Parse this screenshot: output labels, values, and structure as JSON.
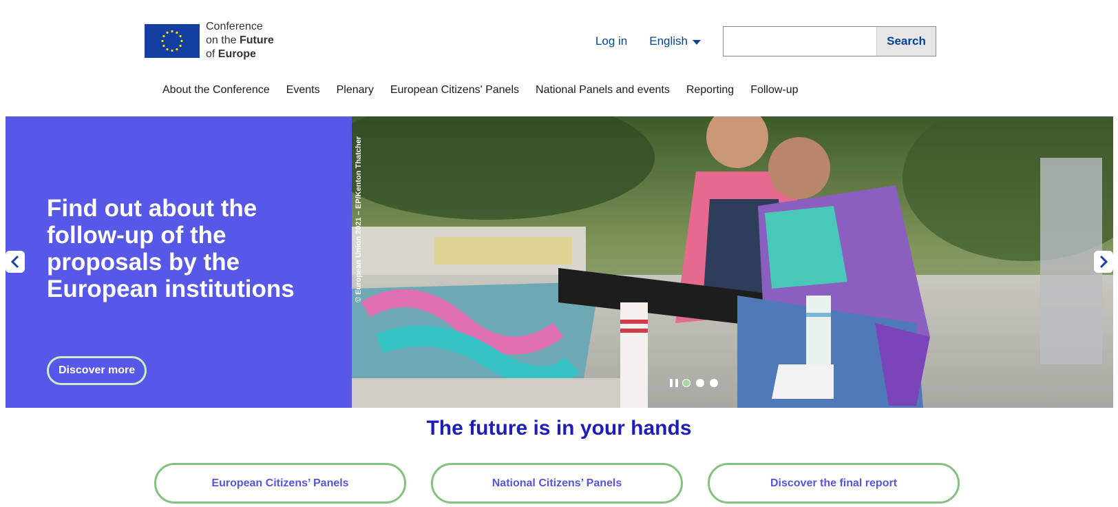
{
  "header": {
    "logo": {
      "line1": "Conference",
      "line2_a": "on the ",
      "line2_b": "Future",
      "line3_a": "of ",
      "line3_b": "Europe"
    },
    "login_label": "Log in",
    "language_label": "English",
    "search": {
      "placeholder": "",
      "button_label": "Search"
    }
  },
  "nav": {
    "items": [
      {
        "label": "About the Conference"
      },
      {
        "label": "Events"
      },
      {
        "label": "Plenary"
      },
      {
        "label": "European Citizens' Panels"
      },
      {
        "label": "National Panels and events"
      },
      {
        "label": "Reporting"
      },
      {
        "label": "Follow-up"
      }
    ]
  },
  "hero": {
    "title": "Find out about the follow-up of the proposals by the European institutions",
    "button_label": "Discover more",
    "image_credit": "© European Union 2021 – EP/Kenton Thatcher",
    "slides": {
      "count": 3,
      "active": 1
    }
  },
  "tagline": "The future is in your hands",
  "cta": [
    {
      "label": "European Citizens’ Panels"
    },
    {
      "label": "National Citizens’ Panels"
    },
    {
      "label": "Discover the final report"
    }
  ],
  "colors": {
    "brand_blue": "#004494",
    "hero_panel": "#5858e8",
    "tagline": "#1d1db8",
    "cta_border": "#84c07f",
    "cta_text": "#5656dc"
  }
}
